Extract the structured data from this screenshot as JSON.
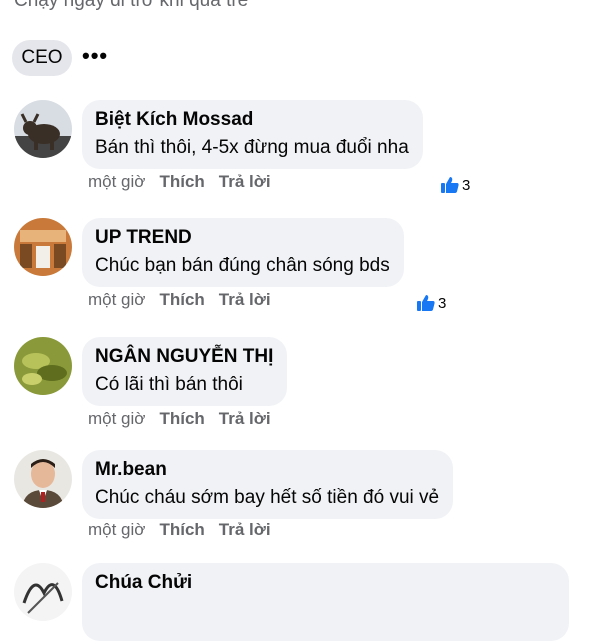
{
  "header": {
    "post_text": "Chạy ngay đi trớ khi quá trễ"
  },
  "reaction_chip": {
    "label": "CEO"
  },
  "more_icon": "more-dots-icon",
  "colors": {
    "bubble": "#f0f2f5",
    "meta_text": "#65676b",
    "like_blue": "#1877f2"
  },
  "comments": [
    {
      "author": "Biệt Kích Mossad",
      "text": "Bán thì thôi, 4-5x đừng mua đuổi nha",
      "time": "một giờ",
      "like_label": "Thích",
      "reply_label": "Trả lời",
      "reactions": "3",
      "avatar_icon": "bull-avatar"
    },
    {
      "author": "UP TREND",
      "text": "Chúc bạn bán đúng chân sóng bds",
      "time": "một giờ",
      "like_label": "Thích",
      "reply_label": "Trả lời",
      "reactions": "3",
      "avatar_icon": "room-avatar"
    },
    {
      "author": "NGÂN NGUYỄN THỊ",
      "text": "Có lãi thì bán thôi",
      "time": "một giờ",
      "like_label": "Thích",
      "reply_label": "Trả lời",
      "avatar_icon": "tea-avatar"
    },
    {
      "author": "Mr.bean",
      "text": "Chúc cháu sớm bay hết số tiền đó vui vẻ",
      "time": "một giờ",
      "like_label": "Thích",
      "reply_label": "Trả lời",
      "avatar_icon": "man-avatar"
    },
    {
      "author": "Chúa Chửi",
      "avatar_icon": "sketch-avatar"
    }
  ]
}
